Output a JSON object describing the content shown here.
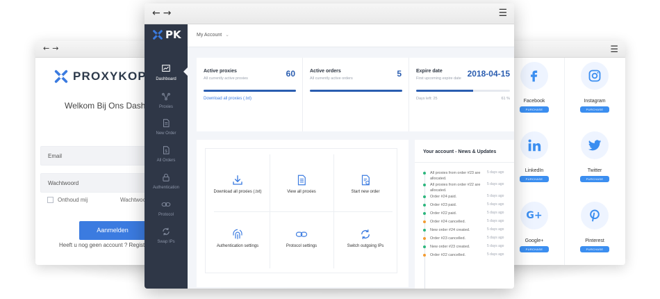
{
  "left_window": {
    "brand": "PROXYKOPEN",
    "welcome": "Welkom Bij Ons Dashboard",
    "email_placeholder": "Email",
    "password_placeholder": "Wachtwoord",
    "remember_label": "Onthoud mij",
    "forgot_label": "Wachtwoord vergeten",
    "login_button": "Aanmelden",
    "signup_text": "Heeft u nog geen account ?  Registreer"
  },
  "center_window": {
    "logo_text": "PK",
    "account_menu": "My Account",
    "sidebar": [
      {
        "label": "Dashboard",
        "icon": "chart-icon",
        "active": true
      },
      {
        "label": "Proxies",
        "icon": "nodes-icon",
        "active": false
      },
      {
        "label": "New Order",
        "icon": "document-icon",
        "active": false
      },
      {
        "label": "All Orders",
        "icon": "dollar-doc-icon",
        "active": false
      },
      {
        "label": "Authentication",
        "icon": "lock-icon",
        "active": false
      },
      {
        "label": "Protocol",
        "icon": "link-icon",
        "active": false
      },
      {
        "label": "Swap IPs",
        "icon": "refresh-icon",
        "active": false
      }
    ],
    "stats": {
      "active_proxies": {
        "title": "Active proxies",
        "subtitle": "All currently active proxies",
        "value": "60",
        "link": "Download all proxies (.txt)",
        "progress": 1.0
      },
      "active_orders": {
        "title": "Active orders",
        "subtitle": "All currently active orders",
        "value": "5",
        "progress": 1.0
      },
      "expire_date": {
        "title": "Expire date",
        "subtitle": "First upcoming expire date",
        "value": "2018-04-15",
        "days_left": "Days left: 25",
        "percent": "61 %",
        "progress": 0.61
      }
    },
    "actions": [
      {
        "label": "Download all proxies (.txt)",
        "icon": "download-icon"
      },
      {
        "label": "View all proxies",
        "icon": "list-doc-icon"
      },
      {
        "label": "Start new order",
        "icon": "new-doc-icon"
      },
      {
        "label": "Authentication settings",
        "icon": "fingerprint-icon"
      },
      {
        "label": "Protocol settings",
        "icon": "link-icon"
      },
      {
        "label": "Switch outgoing IPs",
        "icon": "refresh-icon"
      }
    ],
    "news": {
      "title": "Your account - News & Updates",
      "items": [
        {
          "text": "All proxies from order #23 are allocated.",
          "time": "5 days ago",
          "color": "#2cb67d"
        },
        {
          "text": "All proxies from order #22 are allocated.",
          "time": "5 days ago",
          "color": "#2cb67d"
        },
        {
          "text": "Order #24 paid.",
          "time": "5 days ago",
          "color": "#2cb67d"
        },
        {
          "text": "Order #23 paid.",
          "time": "5 days ago",
          "color": "#2cb67d"
        },
        {
          "text": "Order #22 paid.",
          "time": "5 days ago",
          "color": "#2cb67d"
        },
        {
          "text": "Order #24 cancelled.",
          "time": "5 days ago",
          "color": "#f39c32"
        },
        {
          "text": "New order #24 created.",
          "time": "5 days ago",
          "color": "#2cb67d"
        },
        {
          "text": "Order #23 cancelled.",
          "time": "5 days ago",
          "color": "#f39c32"
        },
        {
          "text": "New order #23 created.",
          "time": "5 days ago",
          "color": "#2cb67d"
        },
        {
          "text": "Order #22 cancelled.",
          "time": "5 days ago",
          "color": "#f39c32"
        }
      ]
    }
  },
  "right_window": {
    "button_label": "PURCHASE",
    "networks": [
      {
        "name": "Facebook",
        "icon": "facebook-icon"
      },
      {
        "name": "Instagram",
        "icon": "instagram-icon"
      },
      {
        "name": "LinkedIn",
        "icon": "linkedin-icon"
      },
      {
        "name": "Twitter",
        "icon": "twitter-icon"
      },
      {
        "name": "Google+",
        "icon": "google-plus-icon"
      },
      {
        "name": "Pinterest",
        "icon": "pinterest-icon"
      }
    ]
  },
  "colors": {
    "accent": "#3b7be0",
    "sidebar": "#2f3747",
    "stat_value": "#2a5db0",
    "social_blue": "#3b8ef0"
  }
}
